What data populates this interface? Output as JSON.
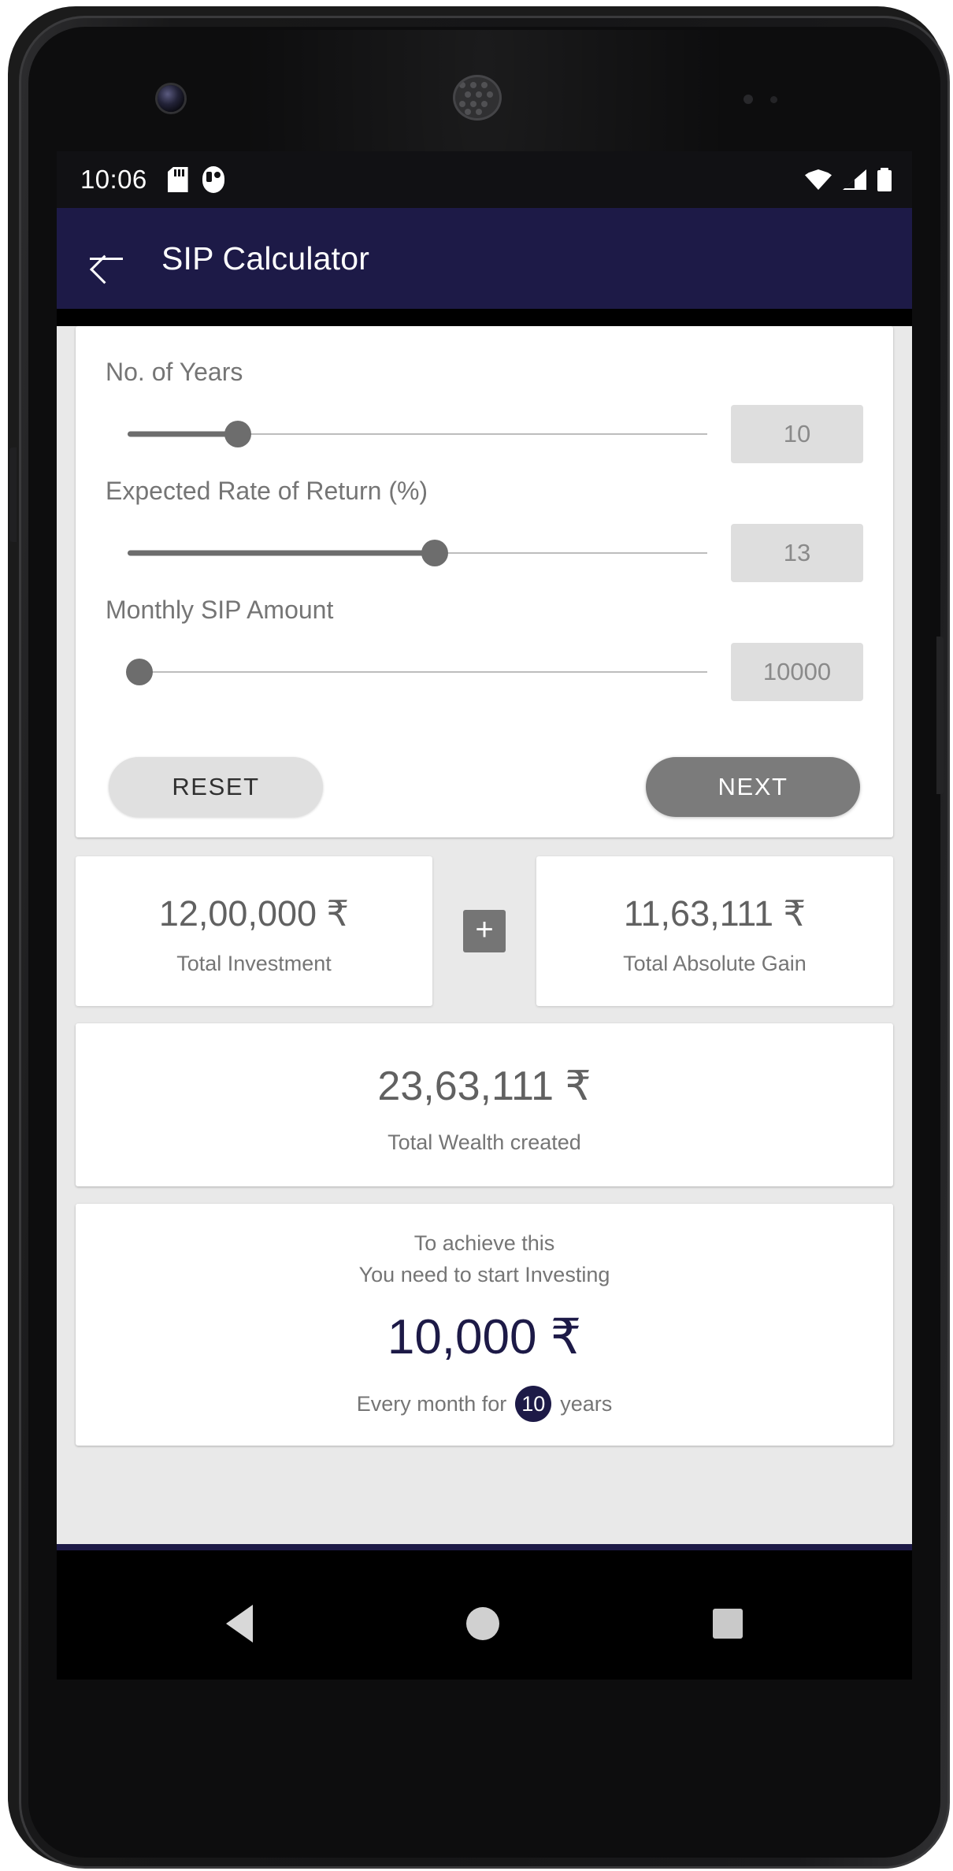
{
  "status_bar": {
    "time": "10:06",
    "left_icons": [
      "sd-card-icon",
      "app-notification-icon"
    ],
    "right_icons": [
      "wifi-icon",
      "cellular-signal-icon",
      "battery-icon"
    ]
  },
  "app_bar": {
    "back_icon": "back-arrow-icon",
    "title": "SIP Calculator",
    "background_color": "#1d1a47"
  },
  "inputs": {
    "fields": [
      {
        "label": "No. of Years",
        "value": "10",
        "thumb_percent": 19,
        "name": "years"
      },
      {
        "label": "Expected Rate of Return (%)",
        "value": "13",
        "thumb_percent": 53,
        "name": "rate-of-return"
      },
      {
        "label": "Monthly SIP Amount",
        "value": "10000",
        "thumb_percent": 2,
        "name": "monthly-sip-amount"
      }
    ],
    "reset_label": "RESET",
    "next_label": "NEXT"
  },
  "results": {
    "investment": {
      "amount": "12,00,000 ₹",
      "label": "Total Investment"
    },
    "operator": "+",
    "gain": {
      "amount": "11,63,111 ₹",
      "label": "Total Absolute Gain"
    },
    "total": {
      "amount": "23,63,111 ₹",
      "label": "Total Wealth created"
    }
  },
  "achieve": {
    "line1": "To achieve this",
    "line2": "You need to start Investing",
    "amount": "10,000 ₹",
    "foot_prefix": "Every month for",
    "years_badge": "10",
    "foot_suffix": "years"
  },
  "nav_bar": {
    "back": "nav-back-triangle-icon",
    "home": "nav-home-circle-icon",
    "recents": "nav-recents-square-icon"
  }
}
